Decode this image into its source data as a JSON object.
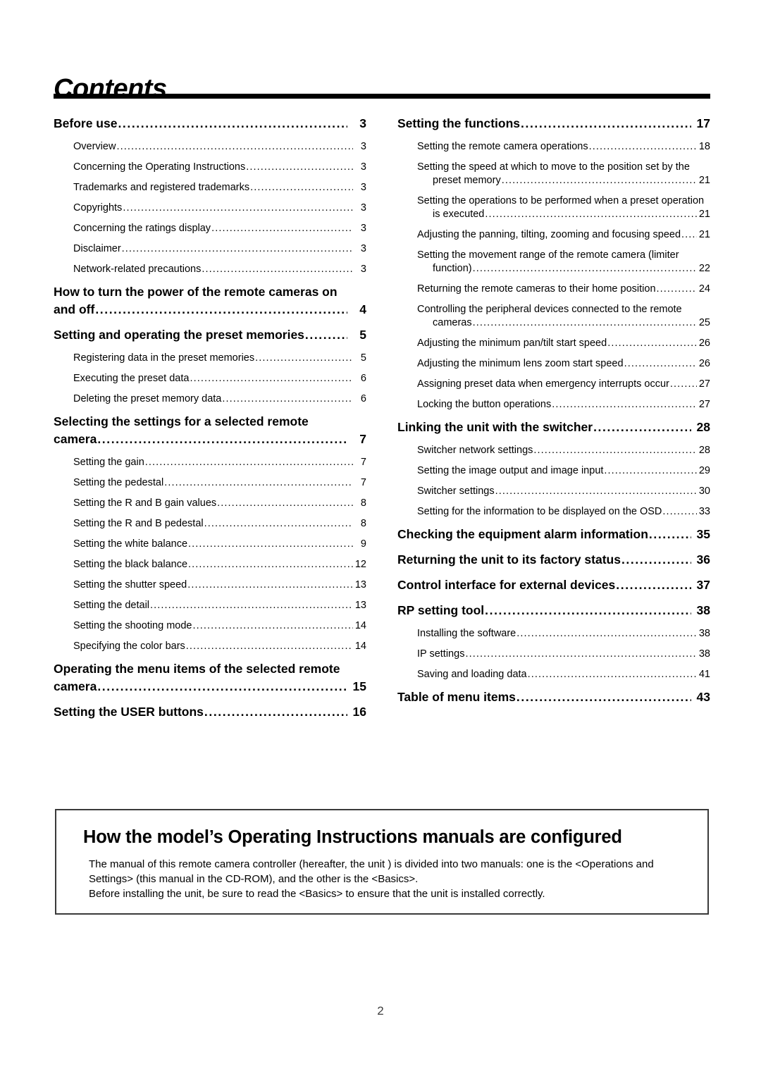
{
  "page": {
    "title": "Contents",
    "folio": "2"
  },
  "toc": {
    "left_column": [
      {
        "level": 1,
        "text": "Before use",
        "page": "3"
      },
      {
        "level": 2,
        "text": "Overview",
        "page": "3"
      },
      {
        "level": 2,
        "text": "Concerning the Operating Instructions",
        "page": "3"
      },
      {
        "level": 2,
        "text": "Trademarks and registered trademarks",
        "page": "3"
      },
      {
        "level": 2,
        "text": "Copyrights",
        "page": "3"
      },
      {
        "level": 2,
        "text": "Concerning the ratings display",
        "page": "3"
      },
      {
        "level": 2,
        "text": "Disclaimer",
        "page": "3"
      },
      {
        "level": 2,
        "text": "Network-related precautions",
        "page": "3"
      },
      {
        "level": 1,
        "text_line1": "How to turn the power of the remote cameras on",
        "text": "and off",
        "page": "4"
      },
      {
        "level": 1,
        "text": "Setting and operating the preset memories",
        "page": "5"
      },
      {
        "level": 2,
        "text": "Registering data in the preset memories",
        "page": "5"
      },
      {
        "level": 2,
        "text": "Executing the preset data",
        "page": "6"
      },
      {
        "level": 2,
        "text": "Deleting the preset memory data",
        "page": "6"
      },
      {
        "level": 1,
        "text_line1": "Selecting the settings for a selected remote",
        "text": "camera",
        "page": "7"
      },
      {
        "level": 2,
        "text": "Setting the gain",
        "page": "7"
      },
      {
        "level": 2,
        "text": "Setting the pedestal",
        "page": "7"
      },
      {
        "level": 2,
        "text": "Setting the R and B gain values",
        "page": "8"
      },
      {
        "level": 2,
        "text": "Setting the R and B pedestal",
        "page": "8"
      },
      {
        "level": 2,
        "text": "Setting the white balance",
        "page": "9"
      },
      {
        "level": 2,
        "text": "Setting the black balance",
        "page": "12"
      },
      {
        "level": 2,
        "text": "Setting the shutter speed",
        "page": "13"
      },
      {
        "level": 2,
        "text": "Setting the detail",
        "page": "13"
      },
      {
        "level": 2,
        "text": "Setting the shooting mode",
        "page": "14"
      },
      {
        "level": 2,
        "text": "Specifying the color bars",
        "page": "14"
      },
      {
        "level": 1,
        "text_line1": "Operating the menu items of the selected remote",
        "text": "camera",
        "page": "15"
      },
      {
        "level": 1,
        "text": "Setting the USER buttons",
        "page": "16"
      }
    ],
    "right_column": [
      {
        "level": 1,
        "text": "Setting the functions",
        "page": "17"
      },
      {
        "level": 2,
        "text": "Setting the remote camera operations",
        "page": "18"
      },
      {
        "level": 2,
        "text_line1": "Setting the speed at which to move to the position set by the",
        "text": "preset memory",
        "page": "21"
      },
      {
        "level": 2,
        "text_line1": "Setting the operations to be performed when a preset operation",
        "text": "is executed",
        "page": "21"
      },
      {
        "level": 2,
        "text": "Adjusting the panning, tilting, zooming and focusing speed",
        "page": "21"
      },
      {
        "level": 2,
        "text_line1": "Setting the movement range of the remote camera (limiter",
        "text": "function)",
        "page": "22"
      },
      {
        "level": 2,
        "text": "Returning the remote cameras to their home position",
        "page": "24"
      },
      {
        "level": 2,
        "text_line1": "Controlling the peripheral devices connected to the remote",
        "text": "cameras",
        "page": "25"
      },
      {
        "level": 2,
        "text": "Adjusting the minimum pan/tilt start speed",
        "page": "26"
      },
      {
        "level": 2,
        "text": "Adjusting the minimum lens zoom start speed",
        "page": "26"
      },
      {
        "level": 2,
        "text": "Assigning preset data when emergency interrupts occur",
        "page": "27"
      },
      {
        "level": 2,
        "text": "Locking the button operations",
        "page": "27"
      },
      {
        "level": 1,
        "text": "Linking the unit with the switcher",
        "page": "28"
      },
      {
        "level": 2,
        "text": "Switcher network settings",
        "page": "28"
      },
      {
        "level": 2,
        "text": "Setting the image output and image input",
        "page": "29"
      },
      {
        "level": 2,
        "text": "Switcher settings",
        "page": "30"
      },
      {
        "level": 2,
        "text": "Setting for the information to be displayed on the OSD",
        "page": "33"
      },
      {
        "level": 1,
        "text": "Checking the equipment alarm information",
        "page": "35"
      },
      {
        "level": 1,
        "text": "Returning the unit to its factory status",
        "page": "36"
      },
      {
        "level": 1,
        "text": "Control interface for external devices",
        "page": "37"
      },
      {
        "level": 1,
        "text": "RP setting tool",
        "page": "38"
      },
      {
        "level": 2,
        "text": "Installing the software",
        "page": "38"
      },
      {
        "level": 2,
        "text": "IP settings",
        "page": "38"
      },
      {
        "level": 2,
        "text": "Saving and loading data",
        "page": "41"
      },
      {
        "level": 1,
        "text": "Table of menu items",
        "page": "43"
      }
    ]
  },
  "callout": {
    "title": "How the model’s Operating Instructions manuals are configured",
    "paragraph1": "The manual of this remote camera controller (hereafter,  the unit ) is divided into two manuals: one is the <Operations and Settings> (this manual in the CD-ROM), and the other is the <Basics>.",
    "paragraph2": "Before installing the unit, be sure to read the <Basics> to ensure that the unit is installed correctly."
  }
}
